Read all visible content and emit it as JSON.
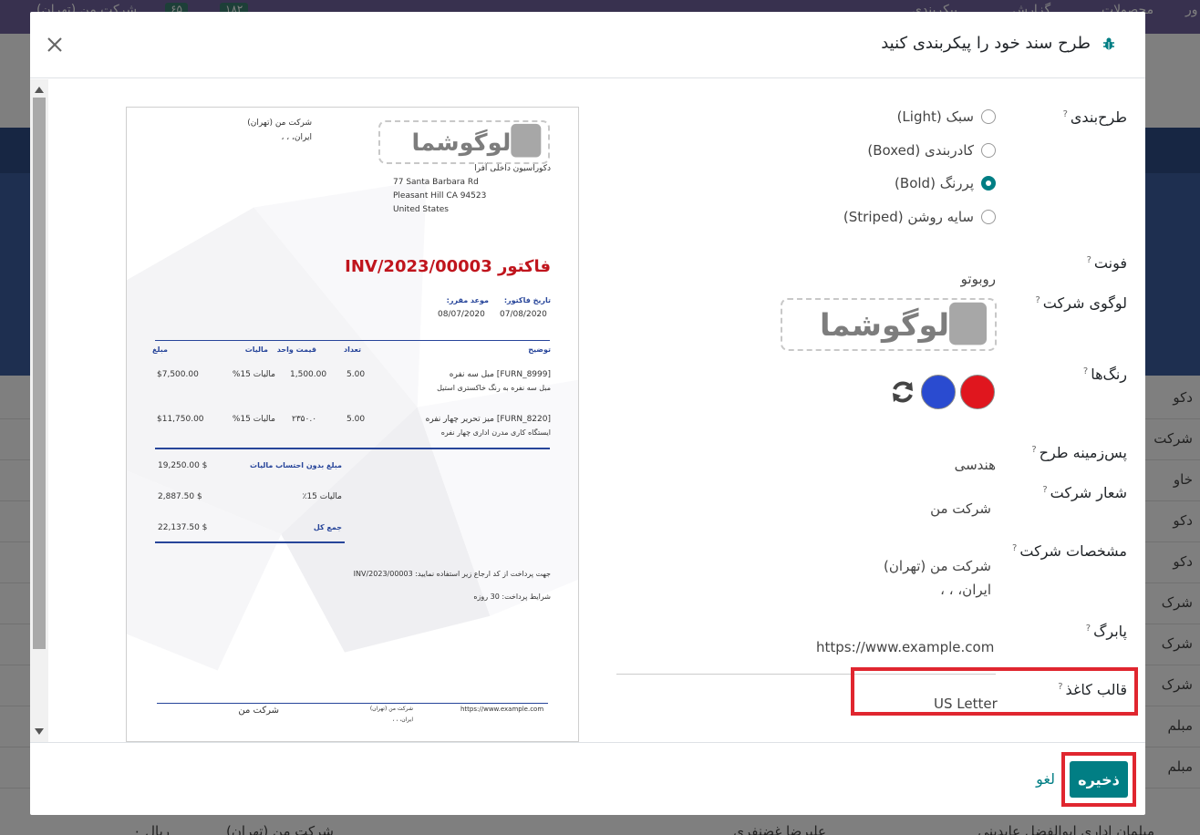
{
  "background": {
    "topbar_items": [
      "گزارش",
      "پیکربندی",
      "محصولات",
      "شرکت من (تهران)"
    ],
    "counts": [
      "۶۵",
      "۱۸۲"
    ],
    "rows": [
      "دکو",
      "شرکت",
      "خاو",
      "دکو",
      "دکو",
      "شرک",
      "شرک",
      "شرک",
      "مبلم",
      "مبلم"
    ],
    "bottom_row": {
      "col1": "مبلمان اداری ابوالفضل عابدینی",
      "col2": "علیرضا غضنفری",
      "col3": "شرکت من (تهران)",
      "col4": "ریال ۰"
    }
  },
  "modal": {
    "title": "طرح سند خود را پیکربندی کنید",
    "form": {
      "layout_label": "طرح‌بندی",
      "layout_options": [
        {
          "label": "سبک (Light)",
          "checked": false
        },
        {
          "label": "کادربندی (Boxed)",
          "checked": false
        },
        {
          "label": "پررنگ (Bold)",
          "checked": true
        },
        {
          "label": "سایه روشن (Striped)",
          "checked": false
        }
      ],
      "font_label": "فونت",
      "font_value": "روبوتو",
      "logo_label": "لوگوی شرکت",
      "logo_text": "لوگوشما",
      "colors_label": "رنگ‌ها",
      "colors": [
        "#e0161e",
        "#2a4bd0"
      ],
      "background_label": "پس‌زمینه طرح",
      "background_value": "هندسی",
      "tagline_label": "شعار شرکت",
      "tagline_value": "شرکت من",
      "details_label": "مشخصات شرکت",
      "details_line1": "شرکت من (تهران)",
      "details_line2": "ایران، ، ،",
      "footer_label": "پابرگ",
      "footer_value": "https://www.example.com",
      "paper_label": "قالب کاغذ",
      "paper_value": "US Letter",
      "help_mark": "?"
    },
    "preview": {
      "company_name": "شرکت من (تهران)",
      "company_country": "ایران، ، ،",
      "logo_text": "لوگوشما",
      "partner_name": "دکوراسیون داخلی آفرا",
      "addr1": "77 Santa Barbara Rd",
      "addr2": "Pleasant Hill CA 94523",
      "addr3": "United States",
      "invoice_title": "فاکتور INV/2023/00003",
      "date_label": "تاریخ فاکتور:",
      "date_value": "07/08/2020",
      "due_label": "موعد مقرر:",
      "due_value": "08/07/2020",
      "th_desc": "توضیح",
      "th_qty": "تعداد",
      "th_price": "قیمت واحد",
      "th_tax": "مالیات",
      "th_amount": "مبلغ",
      "lines": [
        {
          "desc1": "[FURN_8999] مبل سه نفره",
          "desc2": "مبل سه نفره به رنگ خاکستری استیل",
          "qty": "5.00",
          "price": "1,500.00",
          "tax": "مالیات 15%",
          "amount": "$7,500.00"
        },
        {
          "desc1": "[FURN_8220] میز تحریر چهار نفره",
          "desc2": "ایستگاه کاری مدرن اداری چهار نفره",
          "qty": "5.00",
          "price": "۲۳۵۰.۰",
          "tax": "مالیات 15%",
          "amount": "$11,750.00"
        }
      ],
      "untaxed_label": "مبلغ بدون احتساب مالیات",
      "untaxed_value": "19,250.00 $",
      "tax_label": "مالیات 15٪",
      "tax_value": "2,887.50 $",
      "total_label": "جمع کل",
      "total_value": "22,137.50 $",
      "payment_ref": "جهت پرداخت از کد ارجاع زیر استفاده نمایید: INV/2023/00003",
      "payment_terms": "شرایط پرداخت: 30 روزه",
      "footer_url": "https://www.example.com",
      "footer_company": "شرکت من (تهران)",
      "footer_country": "ایران، ، ،",
      "footer_tagline": "شرکت من"
    },
    "buttons": {
      "save": "ذخیره",
      "cancel": "لغو"
    }
  }
}
